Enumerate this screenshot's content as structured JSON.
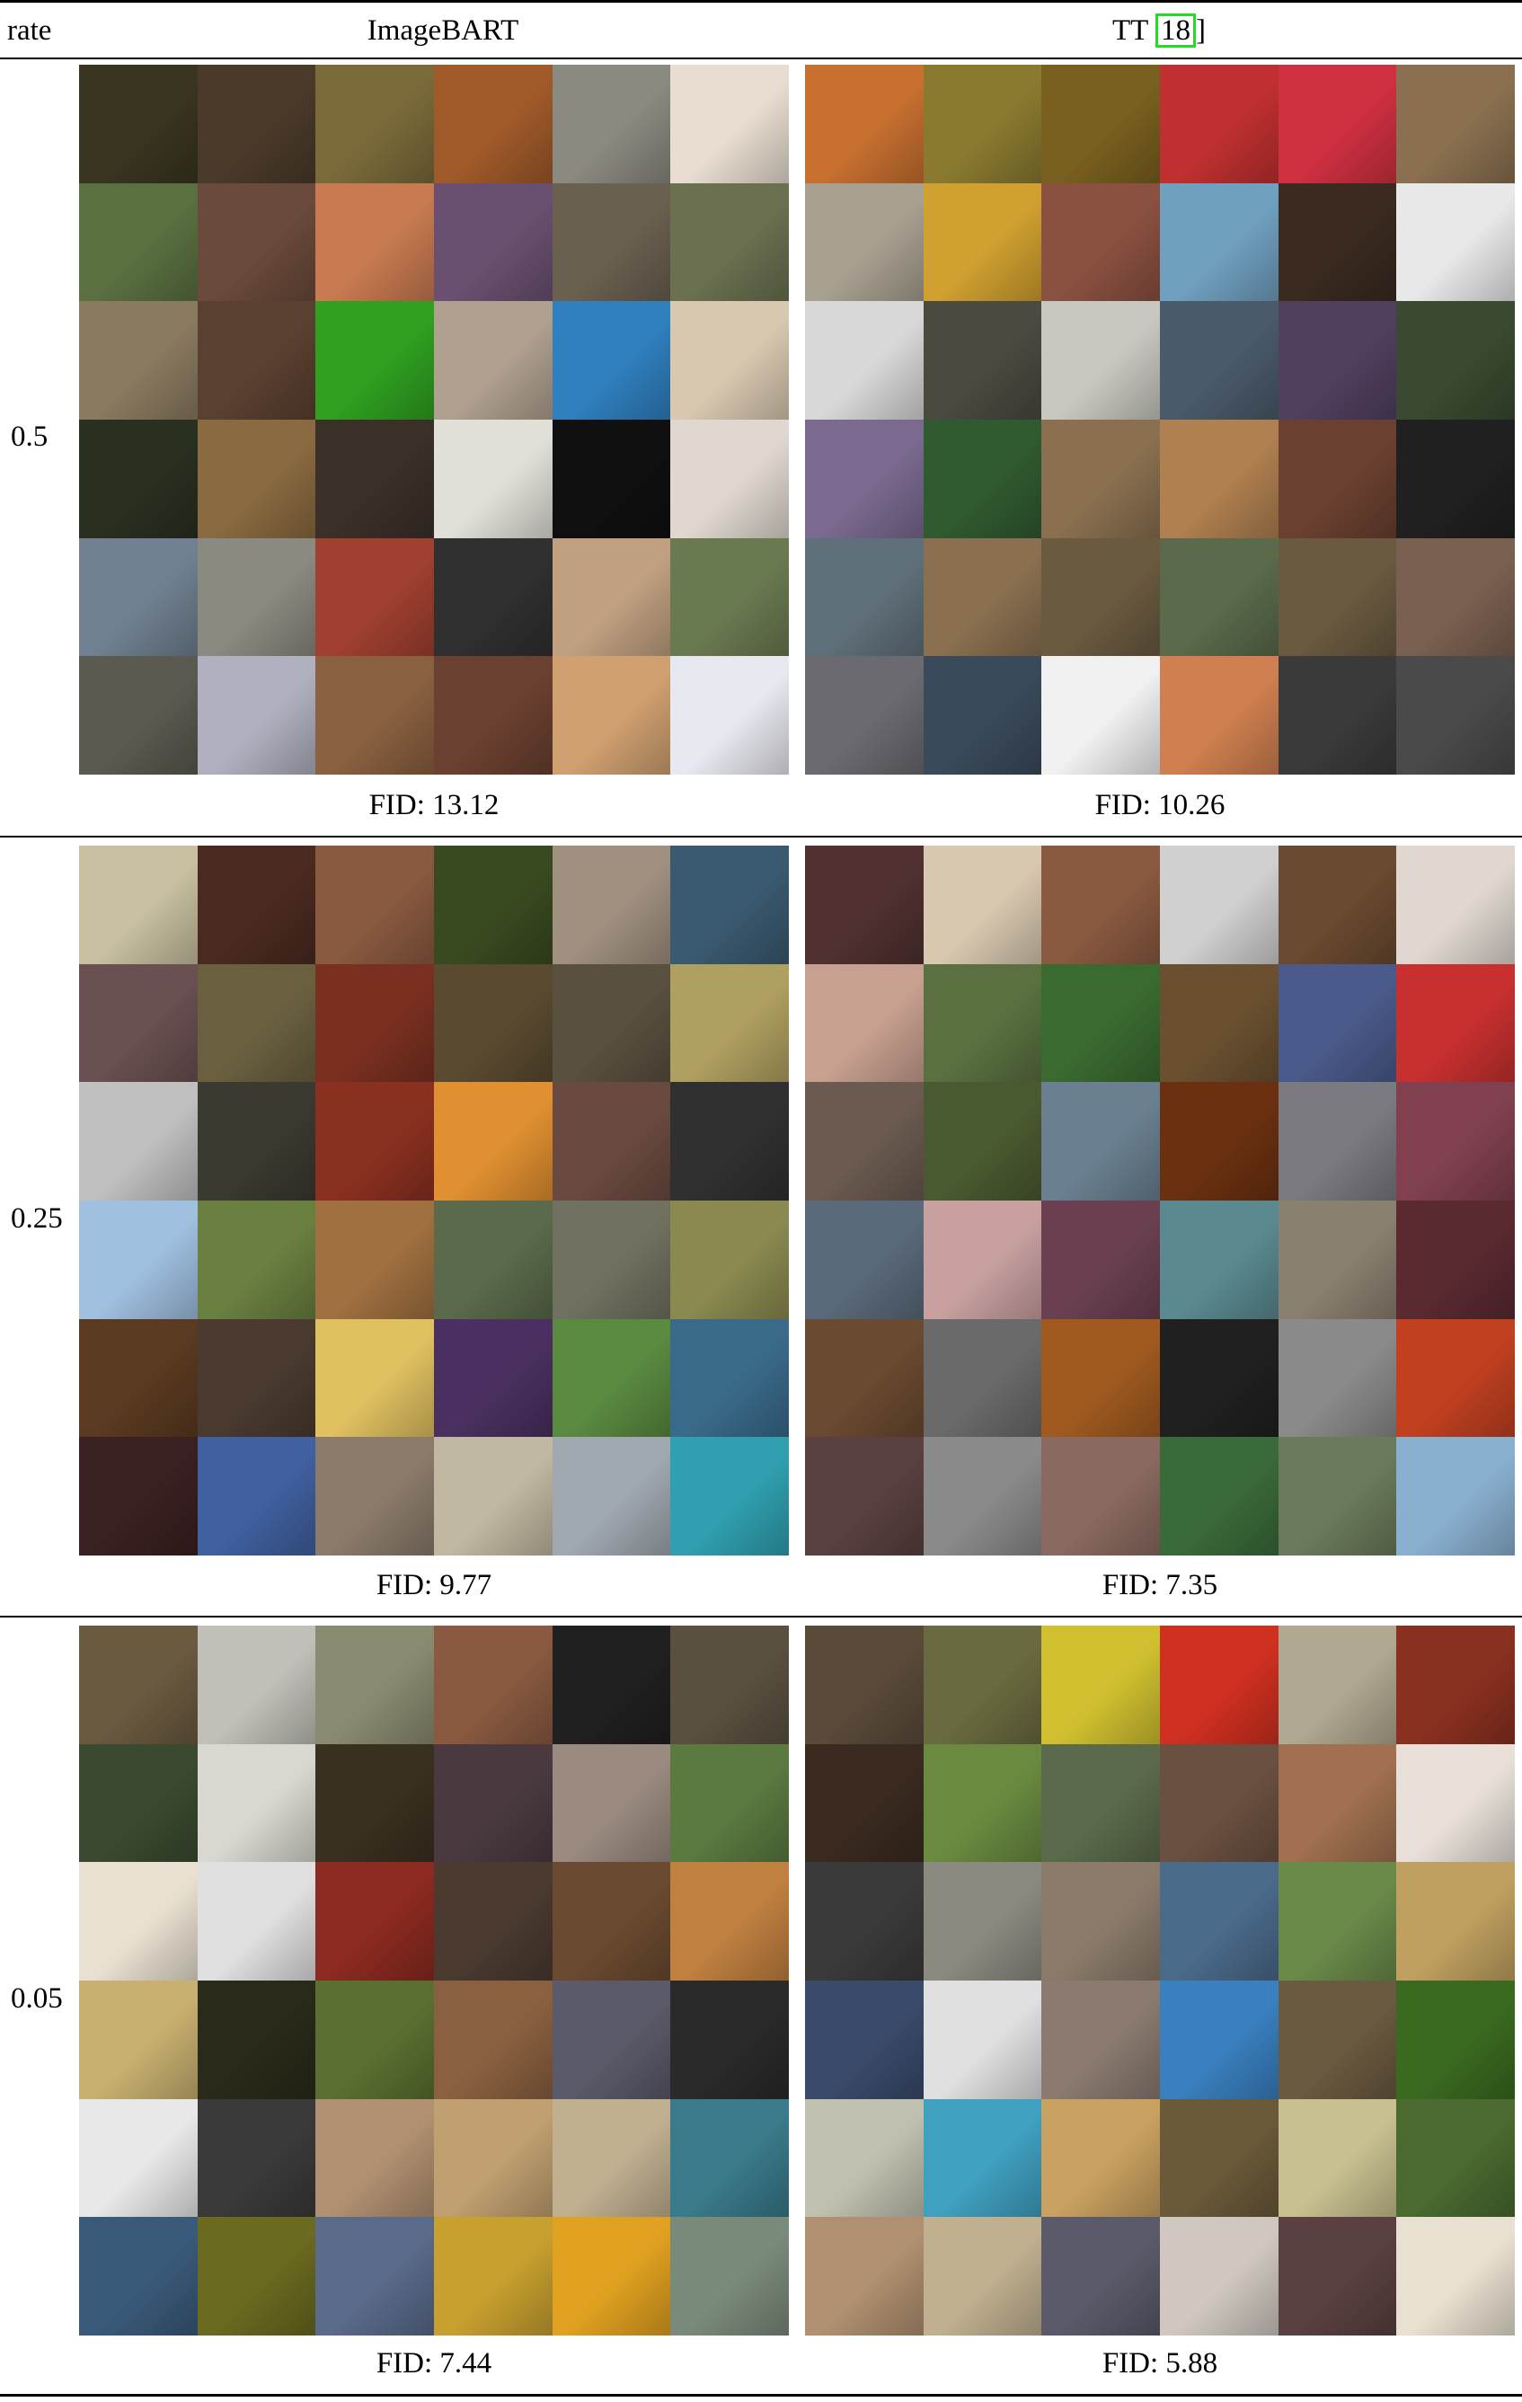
{
  "header": {
    "rate_label": "rate",
    "method_a": "ImageBART",
    "method_b_prefix": "TT ",
    "method_b_cite": "18",
    "method_b_suffix": "]"
  },
  "sections": [
    {
      "rate": "0.5",
      "fid_a": "FID: 13.12",
      "fid_b": "FID: 10.26",
      "colors_a": [
        "#3a3520",
        "#4a3a2a",
        "#7a6a3a",
        "#a05a2a",
        "#8a8a80",
        "#e8ddd0",
        "#5a7040",
        "#6a4a3a",
        "#c87a50",
        "#6a5070",
        "#6a6050",
        "#6a7050",
        "#8a7a60",
        "#5a4030",
        "#30a020",
        "#b0a090",
        "#3080c0",
        "#d8c8b0",
        "#2a3020",
        "#8a6a40",
        "#3a3028",
        "#e0e0d8",
        "#101010",
        "#e0d8d0",
        "#708090",
        "#8a8a80",
        "#a04030",
        "#303030",
        "#c0a080",
        "#6a7a50",
        "#5a5a50",
        "#b0b0c0",
        "#8a6040",
        "#6a4030",
        "#d0a070",
        "#e8e8f0"
      ],
      "colors_b": [
        "#c87030",
        "#8a7a30",
        "#7a6020",
        "#c03030",
        "#d03040",
        "#8a7050",
        "#a8a090",
        "#d0a030",
        "#8a5040",
        "#70a0c0",
        "#3a2a20",
        "#e8e8e8",
        "#d8d8d8",
        "#4a4a40",
        "#c8c8c0",
        "#4a5a6a",
        "#504060",
        "#3a4a30",
        "#7a6a90",
        "#305a30",
        "#8a7050",
        "#b08050",
        "#6a4030",
        "#202020",
        "#60707a",
        "#8a7050",
        "#6a5a40",
        "#5a6a4a",
        "#6a5a40",
        "#7a6050",
        "#6a6a70",
        "#3a4a5a",
        "#f0f0f0",
        "#d08050",
        "#3a3a3a",
        "#4a4a4a"
      ]
    },
    {
      "rate": "0.25",
      "fid_a": "FID: 9.77",
      "fid_b": "FID: 7.35",
      "colors_a": [
        "#c8c0a0",
        "#4a2a20",
        "#8a5a40",
        "#3a4a20",
        "#a09080",
        "#3a5a70",
        "#6a5050",
        "#6a6040",
        "#7a3020",
        "#5a4a30",
        "#5a5040",
        "#b0a060",
        "#c0c0c0",
        "#3a3a30",
        "#8a3020",
        "#e09030",
        "#6a4a40",
        "#303030",
        "#a0c0e0",
        "#6a8040",
        "#a07040",
        "#5a6a4a",
        "#707060",
        "#8a8a50",
        "#5a3a20",
        "#4a3a30",
        "#e0c060",
        "#4a3060",
        "#5a8a40",
        "#3a6a8a",
        "#3a2020",
        "#4060a0",
        "#8a7a6a",
        "#c0b8a0",
        "#a0a8b0",
        "#30a0b0"
      ],
      "colors_b": [
        "#503030",
        "#d8c8b0",
        "#8a5a40",
        "#d0d0d0",
        "#6a4a30",
        "#e0d8d0",
        "#c8a090",
        "#5a7040",
        "#3a6a30",
        "#6a5030",
        "#4a5a8a",
        "#c83030",
        "#6a5a50",
        "#4a5a30",
        "#6a8090",
        "#6a3010",
        "#7a7a80",
        "#804050",
        "#5a6a7a",
        "#c8a0a0",
        "#6a4050",
        "#5a8a90",
        "#8a8070",
        "#5a2a30",
        "#6a4a30",
        "#6a6a6a",
        "#a05a20",
        "#202020",
        "#8a8a8a",
        "#c04020",
        "#5a4040",
        "#8a8a8a",
        "#8a6a60",
        "#3a6a3a",
        "#6a7a5a",
        "#8ab0d0"
      ]
    },
    {
      "rate": "0.05",
      "fid_a": "FID: 7.44",
      "fid_b": "FID: 5.88",
      "colors_a": [
        "#6a5a40",
        "#c0c0b8",
        "#8a8a70",
        "#8a5a40",
        "#202020",
        "#5a5040",
        "#3a4a30",
        "#d8d8d0",
        "#3a3020",
        "#4a3a40",
        "#9a8a80",
        "#5a7a40",
        "#e8e0d0",
        "#e0e0e0",
        "#8a2a20",
        "#4a3a30",
        "#6a4a30",
        "#c08040",
        "#c8b070",
        "#2a2a1a",
        "#5a7030",
        "#8a6040",
        "#5a5a6a",
        "#2a2a2a",
        "#e8e8e8",
        "#3a3a3a",
        "#b09070",
        "#c0a070",
        "#c0b090",
        "#3a7a8a",
        "#3a5a7a",
        "#6a6a20",
        "#5a6a8a",
        "#c8a030",
        "#e0a020",
        "#7a8a7a"
      ],
      "colors_b": [
        "#5a4a3a",
        "#6a6a40",
        "#d0c030",
        "#d03020",
        "#b0a890",
        "#8a3020",
        "#3a2a20",
        "#6a8a40",
        "#5a6a4a",
        "#6a5040",
        "#a07050",
        "#e8e0d8",
        "#3a3a3a",
        "#8a8a80",
        "#8a7a6a",
        "#4a6a8a",
        "#6a8a4a",
        "#c0a060",
        "#3a4a6a",
        "#e0e0e0",
        "#8a7a70",
        "#3a80c0",
        "#6a5a40",
        "#3a6a20",
        "#c0c0b0",
        "#40a0c0",
        "#c8a060",
        "#6a5a3a",
        "#c8c090",
        "#4a6a30",
        "#b09070",
        "#c0b090",
        "#5a5a6a",
        "#d0c8c0",
        "#5a4040",
        "#e8e0d0"
      ]
    }
  ]
}
